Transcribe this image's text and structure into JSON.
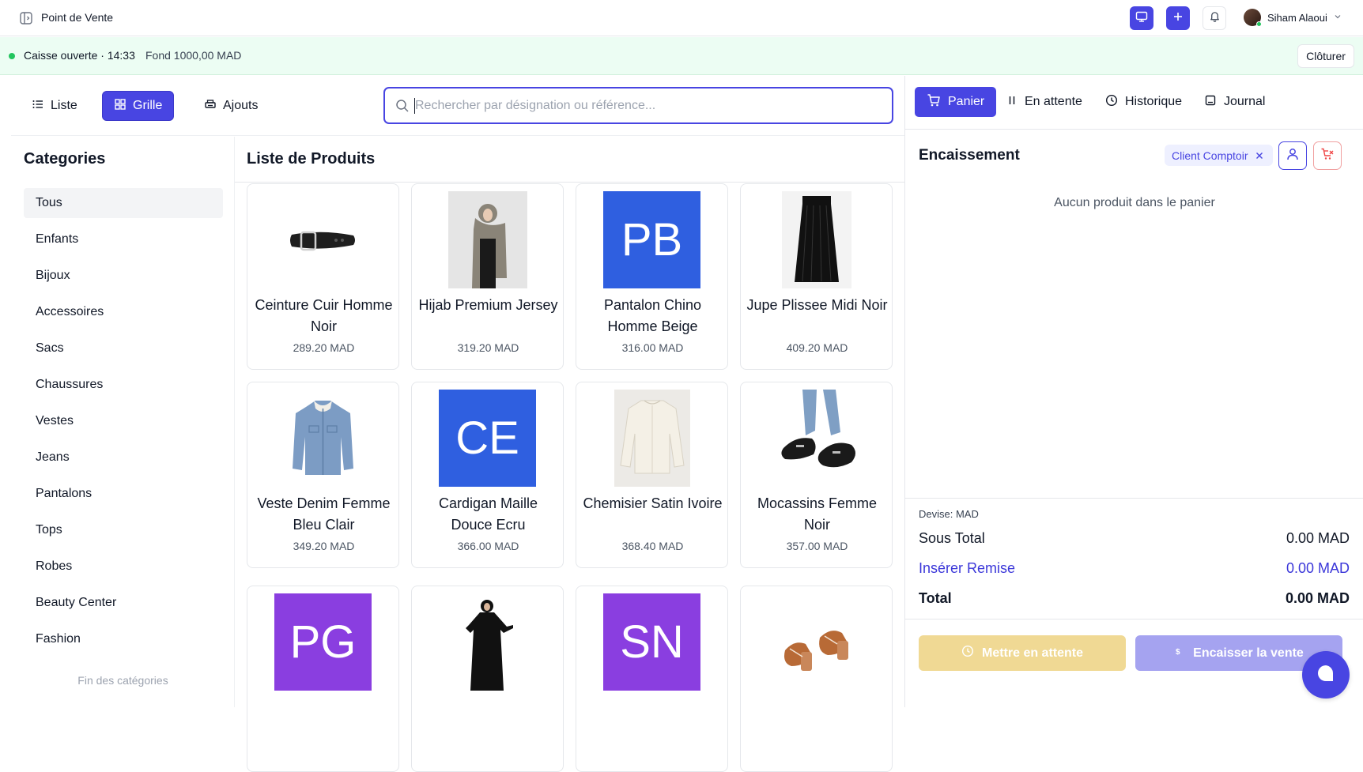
{
  "topbar": {
    "title": "Point de Vente",
    "user_name": "Siham Alaoui",
    "icons": [
      "sidebar-toggle-icon",
      "monitor-icon",
      "plus-icon",
      "bell-icon",
      "chevron-down-icon"
    ]
  },
  "status": {
    "open_text": "Caisse ouverte · 14:33",
    "fund_text": "Fond 1000,00 MAD",
    "close_label": "Clôturer",
    "color": "#22c55e"
  },
  "views": {
    "list_label": "Liste",
    "grid_label": "Grille",
    "additions_label": "Ajouts",
    "active": "Grille"
  },
  "search": {
    "placeholder": "Rechercher par désignation ou référence..."
  },
  "categories": {
    "title": "Categories",
    "items": [
      "Tous",
      "Enfants",
      "Bijoux",
      "Accessoires",
      "Sacs",
      "Chaussures",
      "Vestes",
      "Jeans",
      "Pantalons",
      "Tops",
      "Robes",
      "Beauty Center",
      "Fashion"
    ],
    "active": "Tous",
    "end_text": "Fin des catégories"
  },
  "products": {
    "title": "Liste de Produits",
    "items": [
      {
        "name": "Ceinture Cuir Homme Noir",
        "price": "289.20 MAD",
        "image": "belt"
      },
      {
        "name": "Hijab Premium Jersey",
        "price": "319.20 MAD",
        "image": "hijab"
      },
      {
        "name": "Pantalon Chino Homme Beige",
        "price": "316.00 MAD",
        "initials": "PB",
        "color": "#2f5fe0"
      },
      {
        "name": "Jupe Plissee Midi Noir",
        "price": "409.20 MAD",
        "image": "skirt"
      },
      {
        "name": "Veste Denim Femme Bleu Clair",
        "price": "349.20 MAD",
        "image": "denim-jacket"
      },
      {
        "name": "Cardigan Maille Douce Ecru",
        "price": "366.00 MAD",
        "initials": "CE",
        "color": "#2f5fe0"
      },
      {
        "name": "Chemisier Satin Ivoire",
        "price": "368.40 MAD",
        "image": "blouse"
      },
      {
        "name": "Mocassins Femme Noir",
        "price": "357.00 MAD",
        "image": "loafers"
      },
      {
        "initials": "PG",
        "color": "#8a3ee0"
      },
      {
        "image": "abaya"
      },
      {
        "initials": "SN",
        "color": "#8a3ee0"
      },
      {
        "image": "sandals"
      }
    ]
  },
  "cart": {
    "tabs": [
      "Panier",
      "En attente",
      "Historique",
      "Journal"
    ],
    "active_tab": "Panier",
    "title": "Encaissement",
    "client": "Client Comptoir",
    "empty_text": "Aucun produit dans le panier",
    "currency_label": "Devise: MAD",
    "subtotal_label": "Sous Total",
    "subtotal_value": "0.00 MAD",
    "discount_label": "Insérer Remise",
    "discount_value": "0.00 MAD",
    "total_label": "Total",
    "total_value": "0.00 MAD",
    "hold_label": "Mettre en attente",
    "checkout_label": "Encaisser la vente",
    "hold_color": "#f0d994",
    "checkout_color": "#a5a3f0"
  },
  "colors": {
    "primary": "#4845e2",
    "status_bg": "#ecfdf3",
    "danger": "#ef4444"
  }
}
